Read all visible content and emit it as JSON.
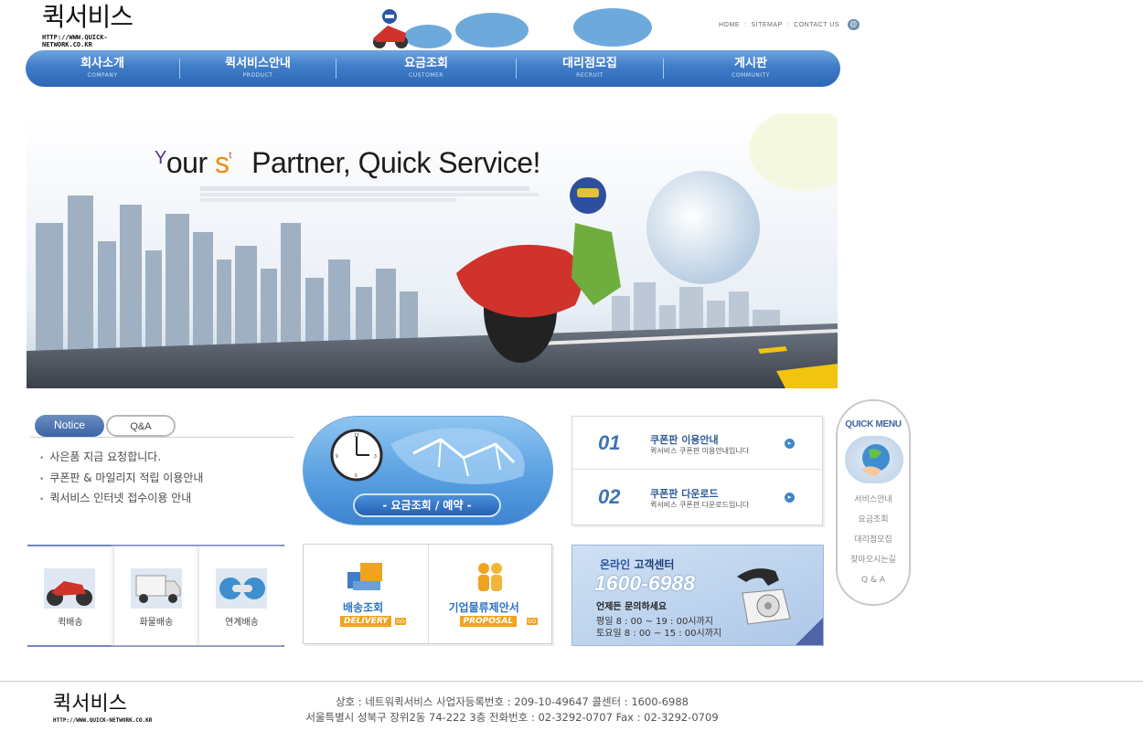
{
  "header": {
    "logo_text": "퀵서비스",
    "logo_url": "HTTP://WWW.QUICK-NETWORK.CO.KR",
    "top_links": [
      "HOME",
      "SITEMAP",
      "CONTACT US"
    ],
    "email_icon": "email-icon"
  },
  "nav": [
    {
      "ko": "회사소개",
      "en": "COMPANY"
    },
    {
      "ko": "퀵서비스안내",
      "en": "PRODUCT"
    },
    {
      "ko": "요금조회",
      "en": "CUSTOMER"
    },
    {
      "ko": "대리점모집",
      "en": "RECRUIT"
    },
    {
      "ko": "게시판",
      "en": "COMMUNITY"
    }
  ],
  "hero": {
    "headline_y": "Y",
    "headline_a": "our",
    "headline_s": "s",
    "headline_t": "t",
    "headline_b": "Partner, Quick Service!"
  },
  "board": {
    "tab_notice": "Notice",
    "tab_qna": "Q&A",
    "items": [
      "사은품 지금 요청합니다.",
      "쿠폰판 & 마일리지 적립 이용안내",
      "퀵서비스 인터넷 접수이용 안내"
    ]
  },
  "reserve": {
    "button_label": "- 요금조회 / 예약 -"
  },
  "coupon": [
    {
      "num": "01",
      "title": "쿠폰판 이용안내",
      "sub": "퀵서비스 쿠폰판 이용안내입니다"
    },
    {
      "num": "02",
      "title": "쿠폰판 다운로드",
      "sub": "퀵서비스 쿠폰판 다운로드입니다"
    }
  ],
  "quick_menu": {
    "title": "QUICK MENU",
    "items": [
      "서비스안내",
      "요금조회",
      "대리점모집",
      "찾아오시는길",
      "Q & A"
    ]
  },
  "delivery_types": [
    "퀵배송",
    "화물배송",
    "연계배송"
  ],
  "services": [
    {
      "ko": "배송조회",
      "en": "DELIVERY",
      "go": "GO"
    },
    {
      "ko": "기업물류제안서",
      "en": "PROPOSAL",
      "go": "GO"
    }
  ],
  "center": {
    "title_a": "온라인",
    "title_b": "고객센터",
    "phone": "1600-6988",
    "ask": "언제든 문의하세요",
    "hours1": "평일  8 : 00 ~ 19 : 00시까지",
    "hours2": "토요일  8 : 00 ~ 15 : 00시까지"
  },
  "footer": {
    "logo_text": "퀵서비스",
    "logo_url": "HTTP://WWW.QUICK-NETWORK.CO.KR",
    "line1": "상호 : 네트워퀵서비스   사업자등록번호 : 209-10-49647   콜센터 : 1600-6988",
    "line2": "서울특별시 성북구 장위2동 74-222 3층 전화번호 : 02-3292-0707  Fax : 02-3292-0709"
  },
  "colors": {
    "nav_blue": "#3f7dc9",
    "accent_orange": "#f0a321",
    "tab_blue": "#3b64a6"
  }
}
